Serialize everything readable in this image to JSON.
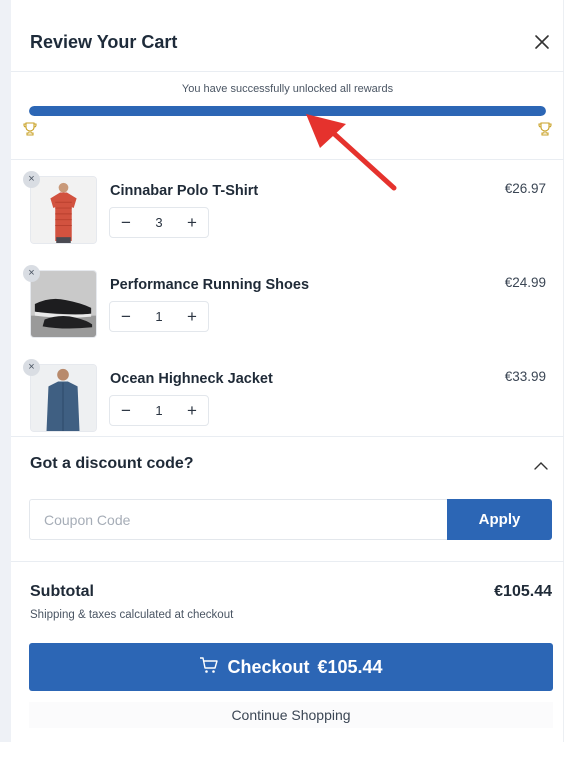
{
  "header": {
    "title": "Review Your Cart"
  },
  "rewards": {
    "message": "You have successfully unlocked all rewards",
    "progress_percent": 100
  },
  "items": [
    {
      "name": "Cinnabar Polo T-Shirt",
      "price": "€26.97",
      "quantity": "3"
    },
    {
      "name": "Performance Running Shoes",
      "price": "€24.99",
      "quantity": "1"
    },
    {
      "name": "Ocean Highneck Jacket",
      "price": "€33.99",
      "quantity": "1"
    }
  ],
  "controls": {
    "minus": "−",
    "plus": "+",
    "remove": "×"
  },
  "discount": {
    "title": "Got a discount code?",
    "placeholder": "Coupon Code",
    "apply_label": "Apply"
  },
  "summary": {
    "subtotal_label": "Subtotal",
    "subtotal_value": "€105.44",
    "shipping_note": "Shipping & taxes calculated at checkout",
    "checkout_label": "Checkout",
    "checkout_amount": "€105.44",
    "continue_label": "Continue Shopping"
  },
  "colors": {
    "primary": "#2c66b5",
    "arrow": "#e5322d",
    "trophy": "#c9a227"
  },
  "icons": {
    "close": "close-icon",
    "trophy": "trophy-icon",
    "chevron": "chevron-up-icon",
    "cart": "cart-icon",
    "remove": "remove-icon"
  }
}
